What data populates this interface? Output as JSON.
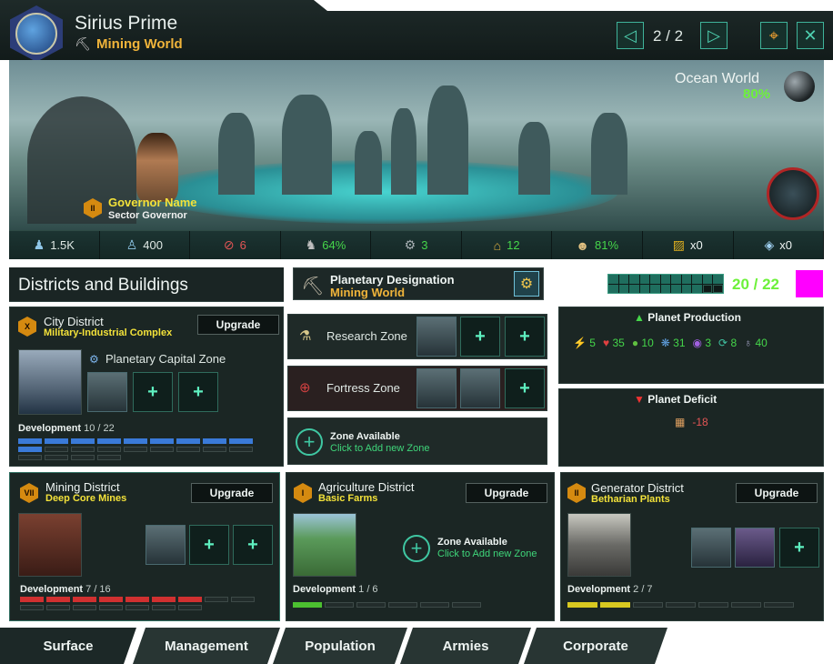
{
  "planet": {
    "name": "Sirius Prime",
    "designation_short": "Mining World",
    "page": "2 / 2",
    "type": "Ocean World",
    "habitability": "80%"
  },
  "governor": {
    "rank": "II",
    "name": "Governor Name",
    "role": "Sector Governor"
  },
  "resources": [
    {
      "icon": "pop-icon",
      "value": "1.5K",
      "color": "#dfe8e4"
    },
    {
      "icon": "pop-growth-icon",
      "value": "400",
      "color": "#dfe8e4"
    },
    {
      "icon": "crime-icon",
      "value": "6",
      "color": "#e35555"
    },
    {
      "icon": "stability-icon",
      "value": "64%",
      "color": "#45d64a"
    },
    {
      "icon": "amenities-icon",
      "value": "3",
      "color": "#45d64a"
    },
    {
      "icon": "housing-icon",
      "value": "12",
      "color": "#45d64a"
    },
    {
      "icon": "happiness-icon",
      "value": "81%",
      "color": "#45d64a"
    },
    {
      "icon": "deviancy-icon",
      "value": "x0",
      "color": "#eef4f2"
    },
    {
      "icon": "energy-node-icon",
      "value": "x0",
      "color": "#eef4f2"
    }
  ],
  "districts_title": "Districts and Buildings",
  "designation": {
    "label": "Planetary Designation",
    "value": "Mining World"
  },
  "capacity": {
    "text": "20 / 22",
    "used": 20,
    "total": 22
  },
  "city": {
    "rank": "X",
    "name": "City District",
    "sub": "Military-Industrial Complex",
    "upgrade": "Upgrade",
    "capital_zone": "Planetary Capital Zone",
    "dev_label": "Development",
    "dev_value": "10 / 22"
  },
  "zones": [
    {
      "label": "Research Zone"
    },
    {
      "label": "Fortress Zone"
    }
  ],
  "zone_available": {
    "title": "Zone Available",
    "sub": "Click to Add new Zone"
  },
  "production": {
    "title": "Planet Production",
    "items": [
      {
        "icon": "energy-icon",
        "value": "5",
        "color": "#45d64a"
      },
      {
        "icon": "unity-icon",
        "value": "35",
        "color": "#45d64a"
      },
      {
        "icon": "food-icon",
        "value": "10",
        "color": "#45d64a"
      },
      {
        "icon": "research-icon",
        "value": "31",
        "color": "#45d64a"
      },
      {
        "icon": "influence-icon",
        "value": "3",
        "color": "#45d64a"
      },
      {
        "icon": "trade-icon",
        "value": "8",
        "color": "#45d64a"
      },
      {
        "icon": "alloys-icon",
        "value": "40",
        "color": "#45d64a"
      }
    ]
  },
  "deficit": {
    "title": "Planet Deficit",
    "items": [
      {
        "icon": "consumer-goods-icon",
        "value": "-18",
        "color": "#e35555"
      }
    ]
  },
  "mining": {
    "rank": "VII",
    "name": "Mining District",
    "sub": "Deep Core Mines",
    "upgrade": "Upgrade",
    "dev_label": "Development",
    "dev_value": "7 / 16"
  },
  "agri": {
    "rank": "I",
    "name": "Agriculture District",
    "sub": "Basic Farms",
    "upgrade": "Upgrade",
    "dev_label": "Development",
    "dev_value": "1 / 6",
    "zone_title": "Zone Available",
    "zone_sub": "Click to Add new Zone"
  },
  "gen": {
    "rank": "II",
    "name": "Generator District",
    "sub": "Betharian Plants",
    "upgrade": "Upgrade",
    "dev_label": "Development",
    "dev_value": "2 / 7"
  },
  "tabs": [
    "Surface",
    "Management",
    "Population",
    "Armies",
    "Corporate"
  ]
}
